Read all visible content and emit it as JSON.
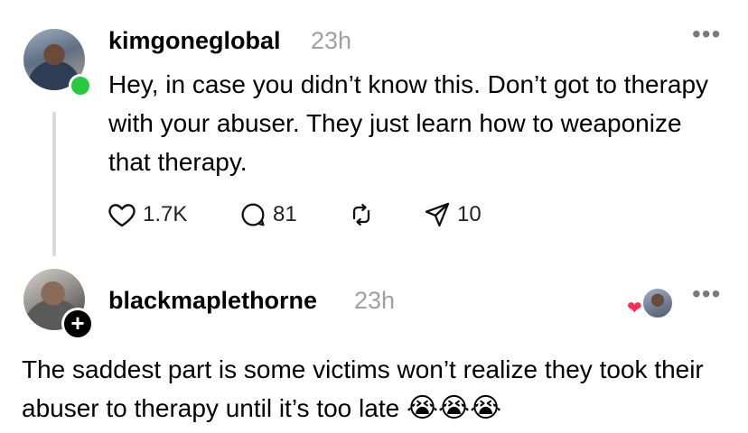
{
  "post": {
    "username": "kimgoneglobal",
    "time": "23h",
    "more_label": "•••",
    "body": "Hey, in case you didn’t know this. Don’t got to therapy with your abuser. They just learn how to weaponize that therapy.",
    "actions": {
      "likes": "1.7K",
      "replies": "81",
      "shares": "10"
    },
    "icons": {
      "like": "heart-icon",
      "reply": "comment-icon",
      "repost": "repost-icon",
      "share": "send-icon"
    },
    "online_status_color": "#27c93f"
  },
  "reply": {
    "username": "blackmaplethorne",
    "time": "23h",
    "more_label": "•••",
    "follow_label": "+",
    "liked_by_heart": "❤",
    "body": "The saddest part is some victims won’t realize they took their abuser to therapy until it’s too late",
    "emojis": "😭😭😭"
  }
}
